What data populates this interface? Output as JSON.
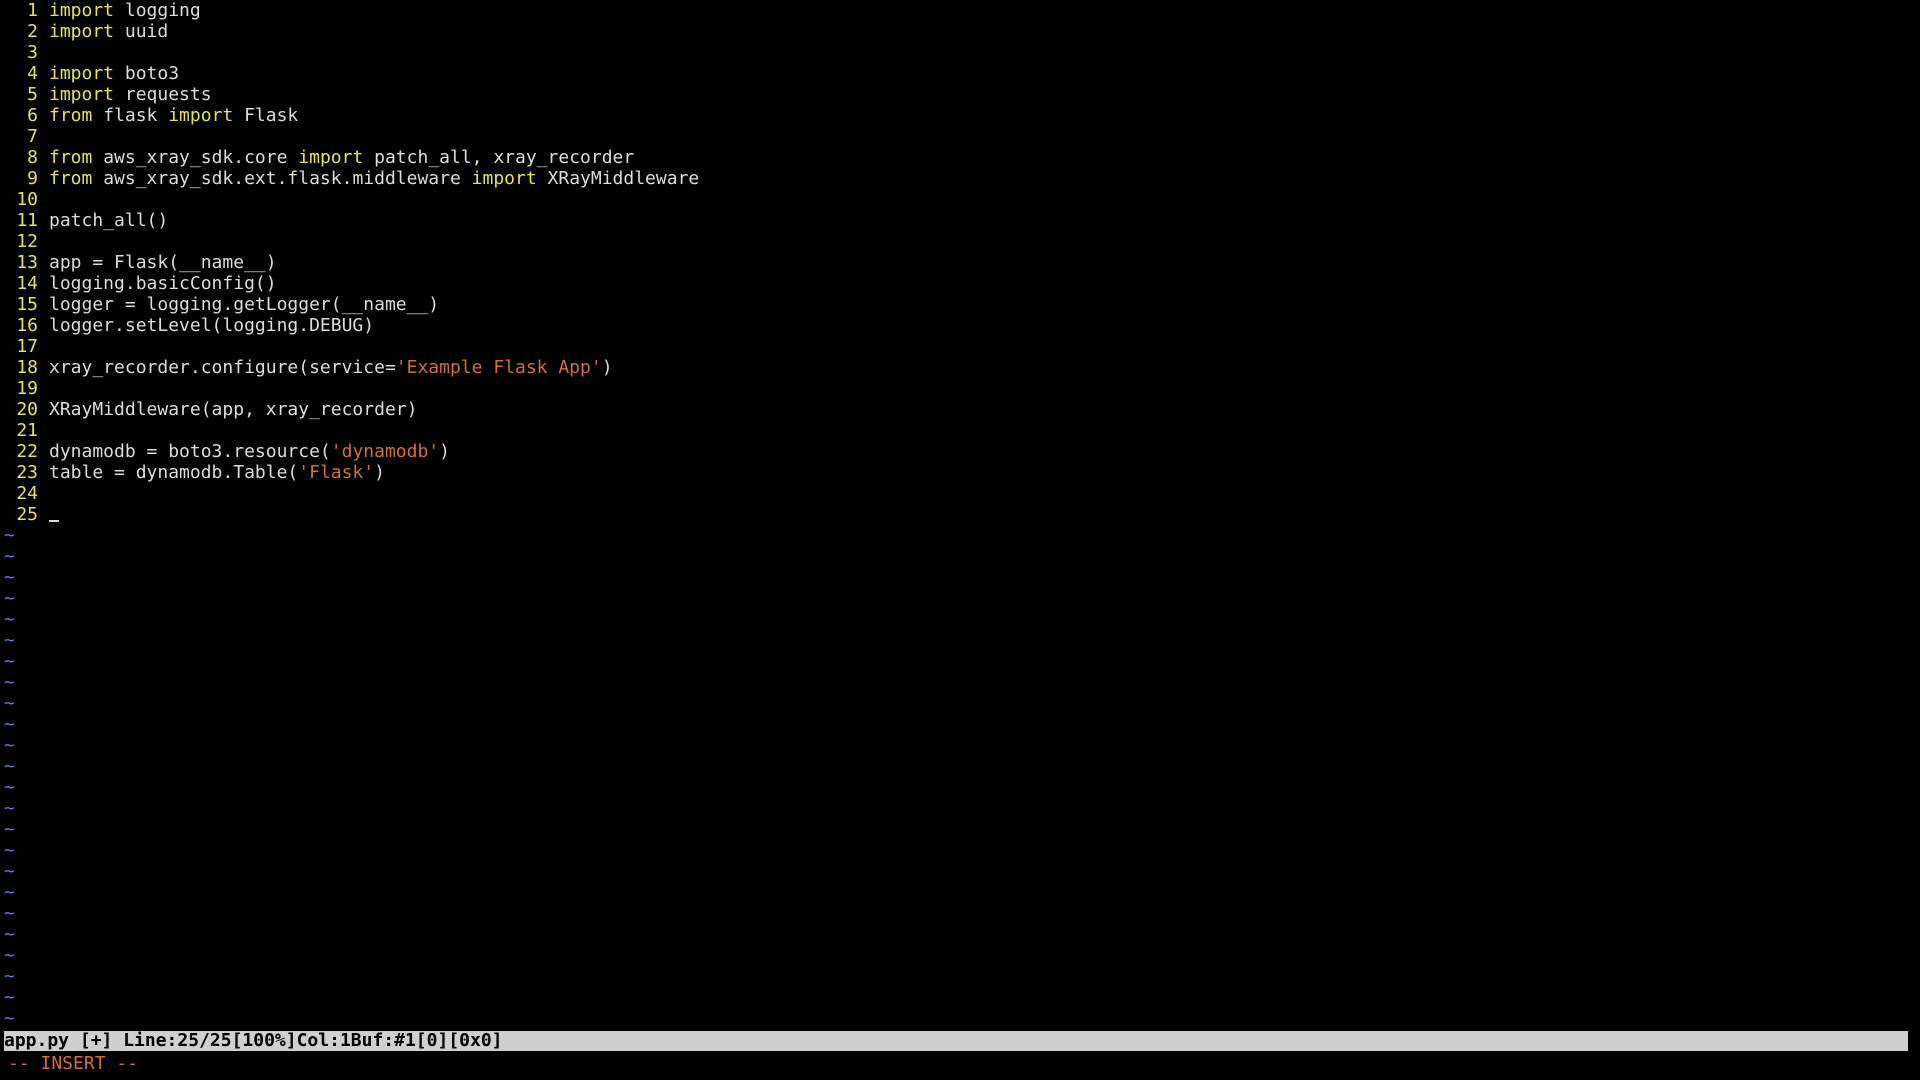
{
  "editor": {
    "file_lines": [
      {
        "num": "1",
        "tokens": [
          {
            "t": "import",
            "k": "kw"
          },
          {
            "t": " logging",
            "k": ""
          }
        ]
      },
      {
        "num": "2",
        "tokens": [
          {
            "t": "import",
            "k": "kw"
          },
          {
            "t": " uuid",
            "k": ""
          }
        ]
      },
      {
        "num": "3",
        "tokens": []
      },
      {
        "num": "4",
        "tokens": [
          {
            "t": "import",
            "k": "kw"
          },
          {
            "t": " boto3",
            "k": ""
          }
        ]
      },
      {
        "num": "5",
        "tokens": [
          {
            "t": "import",
            "k": "kw"
          },
          {
            "t": " requests",
            "k": ""
          }
        ]
      },
      {
        "num": "6",
        "tokens": [
          {
            "t": "from",
            "k": "kw"
          },
          {
            "t": " flask ",
            "k": ""
          },
          {
            "t": "import",
            "k": "kw"
          },
          {
            "t": " Flask",
            "k": ""
          }
        ]
      },
      {
        "num": "7",
        "tokens": []
      },
      {
        "num": "8",
        "tokens": [
          {
            "t": "from",
            "k": "kw"
          },
          {
            "t": " aws_xray_sdk.core ",
            "k": ""
          },
          {
            "t": "import",
            "k": "kw"
          },
          {
            "t": " patch_all, xray_recorder",
            "k": ""
          }
        ]
      },
      {
        "num": "9",
        "tokens": [
          {
            "t": "from",
            "k": "kw"
          },
          {
            "t": " aws_xray_sdk.ext.flask.middleware ",
            "k": ""
          },
          {
            "t": "import",
            "k": "kw"
          },
          {
            "t": " XRayMiddleware",
            "k": ""
          }
        ]
      },
      {
        "num": "10",
        "tokens": []
      },
      {
        "num": "11",
        "tokens": [
          {
            "t": "patch_all()",
            "k": ""
          }
        ]
      },
      {
        "num": "12",
        "tokens": []
      },
      {
        "num": "13",
        "tokens": [
          {
            "t": "app = Flask(__name__)",
            "k": ""
          }
        ]
      },
      {
        "num": "14",
        "tokens": [
          {
            "t": "logging.basicConfig()",
            "k": ""
          }
        ]
      },
      {
        "num": "15",
        "tokens": [
          {
            "t": "logger = logging.getLogger(__name__)",
            "k": ""
          }
        ]
      },
      {
        "num": "16",
        "tokens": [
          {
            "t": "logger.setLevel(logging.DEBUG)",
            "k": ""
          }
        ]
      },
      {
        "num": "17",
        "tokens": []
      },
      {
        "num": "18",
        "tokens": [
          {
            "t": "xray_recorder.configure(service=",
            "k": ""
          },
          {
            "t": "'Example Flask App'",
            "k": "str"
          },
          {
            "t": ")",
            "k": ""
          }
        ]
      },
      {
        "num": "19",
        "tokens": []
      },
      {
        "num": "20",
        "tokens": [
          {
            "t": "XRayMiddleware(app, xray_recorder)",
            "k": ""
          }
        ]
      },
      {
        "num": "21",
        "tokens": []
      },
      {
        "num": "22",
        "tokens": [
          {
            "t": "dynamodb = boto3.resource(",
            "k": ""
          },
          {
            "t": "'dynamodb'",
            "k": "str"
          },
          {
            "t": ")",
            "k": ""
          }
        ]
      },
      {
        "num": "23",
        "tokens": [
          {
            "t": "table = dynamodb.Table(",
            "k": ""
          },
          {
            "t": "'Flask'",
            "k": "str"
          },
          {
            "t": ")",
            "k": ""
          }
        ]
      },
      {
        "num": "24",
        "tokens": []
      },
      {
        "num": "25",
        "tokens": [],
        "cursor": true
      }
    ],
    "empty_marker": "~",
    "empty_marker_count": 24
  },
  "status_bar": {
    "text": "app.py [+] Line:25/25[100%]Col:1Buf:#1[0][0x0]"
  },
  "mode_line": {
    "text": "-- INSERT --"
  },
  "colors": {
    "background": "#000000",
    "line_number": "#e4e45a",
    "keyword": "#e4e45a",
    "string": "#d0703a",
    "tilde": "#6f6fe8",
    "status_bar_bg": "#cfcfcf",
    "mode_text": "#d0703a"
  }
}
